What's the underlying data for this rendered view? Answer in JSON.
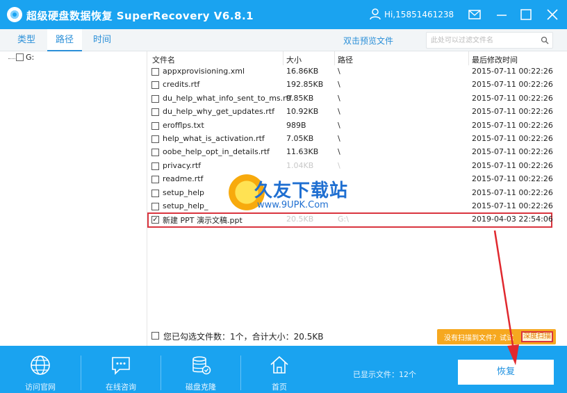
{
  "window": {
    "title": "超级硬盘数据恢复 SuperRecovery V6.8.1",
    "user": "Hi,15851461238"
  },
  "tabs": [
    {
      "label": "类型"
    },
    {
      "label": "路径",
      "active": true
    },
    {
      "label": "时间"
    }
  ],
  "preview_link": "双击预览文件",
  "filter": {
    "placeholder": "此处可以过滤文件名"
  },
  "tree": {
    "root_label": "G:"
  },
  "table": {
    "headers": [
      "文件名",
      "大小",
      "路径",
      "最后修改时间"
    ],
    "rows": [
      {
        "name": "appxprovisioning.xml",
        "size": "16.86KB",
        "path": "\\",
        "modified": "2015-07-11 00:22:26",
        "checked": false
      },
      {
        "name": "credits.rtf",
        "size": "192.85KB",
        "path": "\\",
        "modified": "2015-07-11 00:22:26",
        "checked": false
      },
      {
        "name": "du_help_what_info_sent_to_ms.rtf",
        "size": "9.85KB",
        "path": "\\",
        "modified": "2015-07-11 00:22:26",
        "checked": false
      },
      {
        "name": "du_help_why_get_updates.rtf",
        "size": "10.92KB",
        "path": "\\",
        "modified": "2015-07-11 00:22:26",
        "checked": false
      },
      {
        "name": "erofflps.txt",
        "size": "989B",
        "path": "\\",
        "modified": "2015-07-11 00:22:26",
        "checked": false
      },
      {
        "name": "help_what_is_activation.rtf",
        "size": "7.05KB",
        "path": "\\",
        "modified": "2015-07-11 00:22:26",
        "checked": false
      },
      {
        "name": "oobe_help_opt_in_details.rtf",
        "size": "11.63KB",
        "path": "\\",
        "modified": "2015-07-11 00:22:26",
        "checked": false
      },
      {
        "name": "privacy.rtf",
        "size": "1.04KB",
        "path": "\\",
        "modified": "2015-07-11 00:22:26",
        "checked": false,
        "faded": true
      },
      {
        "name": "readme.rtf",
        "size": "",
        "path": "",
        "modified": "2015-07-11 00:22:26",
        "checked": false,
        "faded": true
      },
      {
        "name": "setup_help",
        "size": "",
        "path": "",
        "modified": "2015-07-11 00:22:26",
        "checked": false,
        "faded": true
      },
      {
        "name": "setup_help_",
        "size": "",
        "path": "",
        "modified": "2015-07-11 00:22:26",
        "checked": false,
        "faded": true
      },
      {
        "name": "新建 PPT 演示文稿.ppt",
        "size": "20.5KB",
        "path": "G:\\",
        "modified": "2019-04-03 22:54:06",
        "checked": true,
        "faded": true,
        "highlight": true
      }
    ]
  },
  "watermark": {
    "title": "久友下载站",
    "url": "www.9UPK.Com"
  },
  "summary": {
    "text": "您已勾选文件数：1个，合计大小：20.5KB"
  },
  "deep_scan": {
    "prompt": "没有扫描到文件？试试",
    "button": "深度扫描"
  },
  "bottom_nav": [
    {
      "label": "访问官网",
      "icon": "globe-icon"
    },
    {
      "label": "在线咨询",
      "icon": "chat-icon"
    },
    {
      "label": "磁盘克隆",
      "icon": "disk-clone-icon"
    },
    {
      "label": "首页",
      "icon": "home-icon"
    }
  ],
  "shown_files": "已显示文件：12个",
  "recover_button": "恢复",
  "colors": {
    "primary": "#1aa3f0",
    "accent_blue": "#2a8fd8",
    "highlight_red": "#d9343e",
    "orange": "#f6a81f"
  }
}
